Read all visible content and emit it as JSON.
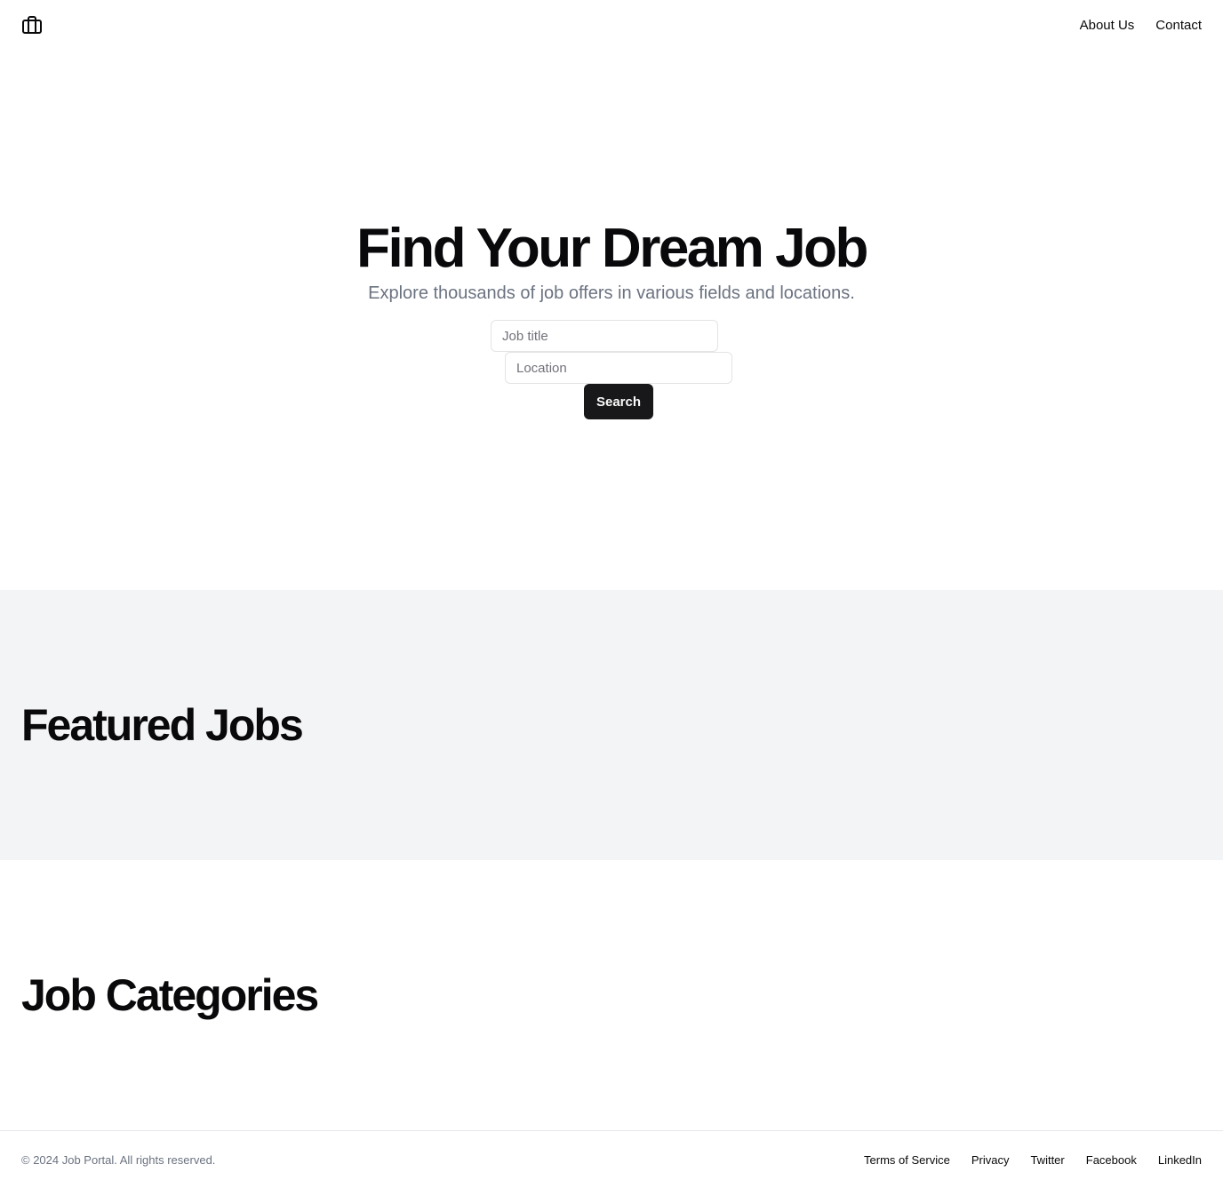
{
  "header": {
    "logo_icon": "briefcase-icon",
    "nav": {
      "about": "About Us",
      "contact": "Contact"
    }
  },
  "hero": {
    "title": "Find Your Dream Job",
    "subtitle": "Explore thousands of job offers in various fields and locations.",
    "job_title_placeholder": "Job title",
    "location_placeholder": "Location",
    "search_label": "Search"
  },
  "featured": {
    "title": "Featured Jobs"
  },
  "categories": {
    "title": "Job Categories"
  },
  "footer": {
    "copyright": "© 2024 Job Portal. All rights reserved.",
    "links": {
      "terms": "Terms of Service",
      "privacy": "Privacy",
      "twitter": "Twitter",
      "facebook": "Facebook",
      "linkedin": "LinkedIn"
    }
  },
  "colors": {
    "primary": "#18181b",
    "muted_text": "#6b7280",
    "section_bg": "#f3f4f6",
    "border": "#e4e4e7"
  }
}
